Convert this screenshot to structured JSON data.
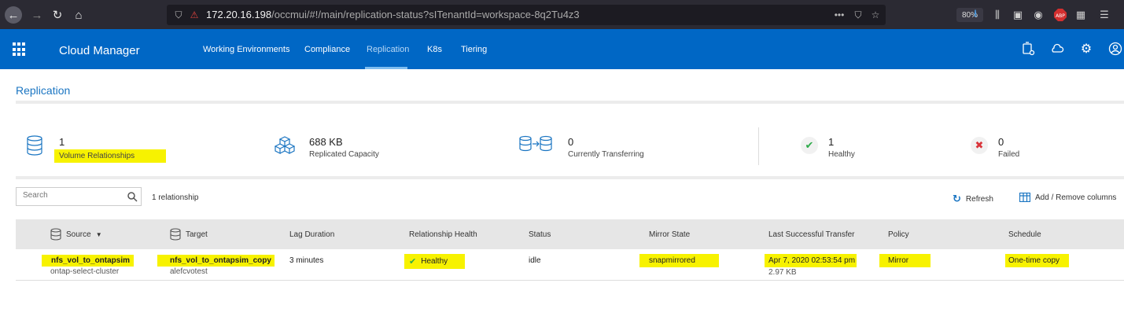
{
  "browser": {
    "url_host": "172.20.16.198",
    "url_path": "/occmui/#!/main/replication-status?sITenantId=workspace-8q2Tu4z3",
    "zoom": "80%"
  },
  "header": {
    "app_title": "Cloud Manager",
    "tabs": [
      {
        "label": "Working Environments",
        "active": false
      },
      {
        "label": "Compliance",
        "active": false
      },
      {
        "label": "Replication",
        "active": true
      },
      {
        "label": "K8s",
        "active": false
      },
      {
        "label": "Tiering",
        "active": false
      }
    ]
  },
  "page": {
    "title": "Replication"
  },
  "stats": [
    {
      "value": "1",
      "label": "Volume Relationships",
      "icon": "database-stack-icon"
    },
    {
      "value": "688 KB",
      "label": "Replicated Capacity",
      "icon": "cubes-icon"
    },
    {
      "value": "0",
      "label": "Currently Transferring",
      "icon": "transfer-icon"
    },
    {
      "value": "1",
      "label": "Healthy",
      "icon": "check-icon"
    },
    {
      "value": "0",
      "label": "Failed",
      "icon": "x-icon"
    }
  ],
  "toolbar": {
    "search_placeholder": "Search",
    "relationship_count": "1 relationship",
    "refresh_label": "Refresh",
    "columns_label": "Add / Remove columns"
  },
  "table": {
    "columns": [
      "Source",
      "Target",
      "Lag Duration",
      "Relationship Health",
      "Status",
      "Mirror State",
      "Last Successful Transfer",
      "Policy",
      "Schedule"
    ],
    "rows": [
      {
        "source": "nfs_vol_to_ontapsim",
        "source_cluster": "ontap-select-cluster",
        "target": "nfs_vol_to_ontapsim_copy",
        "target_env": "alefcvotest",
        "lag_duration": "3 minutes",
        "health": "Healthy",
        "status": "idle",
        "mirror_state": "snapmirrored",
        "last_transfer": "Apr 7, 2020 02:53:54 pm",
        "last_transfer_size": "2.97 KB",
        "policy": "Mirror",
        "schedule": "One-time copy"
      }
    ]
  },
  "colors": {
    "header_blue": "#0067c5",
    "highlight": "#f7f200",
    "healthy_green": "#2eab4a",
    "failed_red": "#d9343a"
  }
}
